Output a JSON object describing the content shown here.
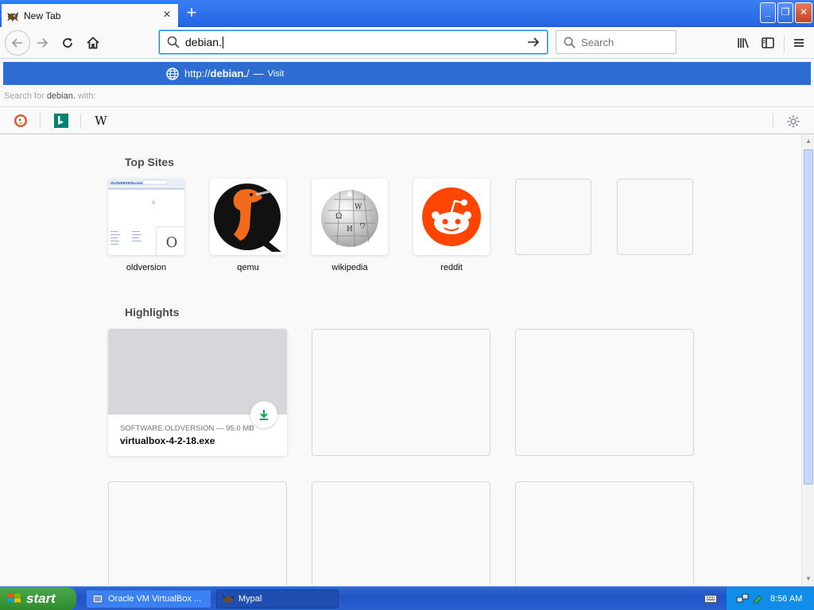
{
  "window": {
    "tab_title": "New Tab",
    "close_tab_glyph": "×",
    "new_tab_glyph": "+",
    "controls": {
      "minimize": "_",
      "maximize": "❐",
      "close": "✕"
    }
  },
  "toolbar": {
    "url_value": "debian.",
    "search_placeholder": "Search",
    "icons": [
      "back-icon",
      "forward-icon",
      "reload-icon",
      "home-icon",
      "library-icon",
      "sidebar-icon",
      "menu-icon"
    ]
  },
  "urlbar_dropdown": {
    "suggestion": {
      "url_prefix": "http://",
      "url_bold": "debian.",
      "url_suffix": "/",
      "separator": "—",
      "action": "Visit"
    },
    "search_for_prefix": "Search for",
    "search_term": "debian.",
    "search_for_suffix": "with:",
    "engines": [
      "duckduckgo",
      "bing",
      "wikipedia"
    ],
    "wikipedia_glyph": "W"
  },
  "top_sites": {
    "heading": "Top Sites",
    "tiles": [
      {
        "label": "oldversion",
        "badge": "O"
      },
      {
        "label": "qemu"
      },
      {
        "label": "wikipedia"
      },
      {
        "label": "reddit"
      },
      {
        "label": ""
      },
      {
        "label": ""
      }
    ],
    "oldversion_thumb_text": "OLDVERSION.com"
  },
  "highlights": {
    "heading": "Highlights",
    "cards": [
      {
        "meta": "SOFTWARE.OLDVERSION — 95.0 MB",
        "title": "virtualbox-4-2-18.exe"
      }
    ]
  },
  "taskbar": {
    "start_label": "start",
    "items": [
      {
        "label": "Oracle VM VirtualBox ...",
        "active": false
      },
      {
        "label": "Mypal",
        "active": true
      }
    ],
    "clock": "8:56 AM"
  },
  "colors": {
    "accent": "#0a84ff",
    "suggestion_bg": "#2d6cd0",
    "download_green": "#12a34a",
    "reddit_orange": "#ff4500"
  }
}
